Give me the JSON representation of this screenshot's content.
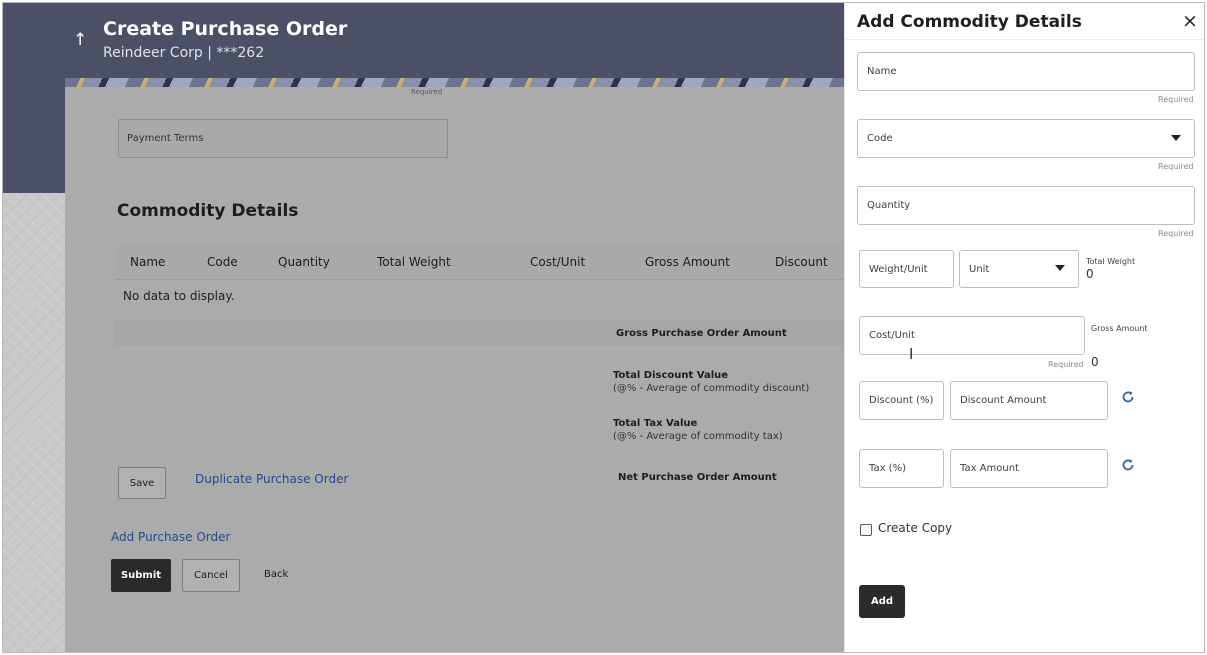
{
  "header": {
    "title": "Create Purchase Order",
    "subtitle": "Reindeer Corp | ***262"
  },
  "form": {
    "required_label": "Required",
    "payment_terms_label": "Payment Terms"
  },
  "commodity_section": {
    "heading": "Commodity Details",
    "columns": [
      "Name",
      "Code",
      "Quantity",
      "Total Weight",
      "Cost/Unit",
      "Gross Amount",
      "Discount"
    ],
    "empty_message": "No data to display.",
    "totals": {
      "gross_label": "Gross Purchase Order Amount",
      "discount_label": "Total Discount Value",
      "discount_sub": "(@% - Average of commodity discount)",
      "tax_label": "Total Tax Value",
      "tax_sub": "(@% - Average of commodity tax)",
      "net_label": "Net Purchase Order Amount"
    },
    "save_label": "Save",
    "duplicate_label": "Duplicate Purchase Order"
  },
  "page_actions": {
    "add_purchase_order": "Add Purchase Order",
    "submit": "Submit",
    "cancel": "Cancel",
    "back": "Back"
  },
  "drawer": {
    "title": "Add Commodity Details",
    "name_placeholder": "Name",
    "code_placeholder": "Code",
    "quantity_placeholder": "Quantity",
    "weight_unit_placeholder": "Weight/Unit",
    "unit_placeholder": "Unit",
    "total_weight_label": "Total Weight",
    "total_weight_value": "0",
    "cost_unit_placeholder": "Cost/Unit",
    "gross_amount_label": "Gross Amount",
    "gross_amount_value": "0",
    "required_label": "Required",
    "discount_pct_placeholder": "Discount (%)",
    "discount_amount_placeholder": "Discount Amount",
    "tax_pct_placeholder": "Tax (%)",
    "tax_amount_placeholder": "Tax Amount",
    "create_copy_label": "Create Copy",
    "add_label": "Add"
  },
  "icons": {
    "back": "up-arrow-icon",
    "close": "close-icon",
    "dropdown": "chevron-down-icon",
    "refresh": "refresh-icon"
  },
  "colors": {
    "header_bg": "#4b5067",
    "primary_button": "#2b2b2b",
    "link": "#27498a",
    "refresh_icon": "#2d6aa0"
  }
}
